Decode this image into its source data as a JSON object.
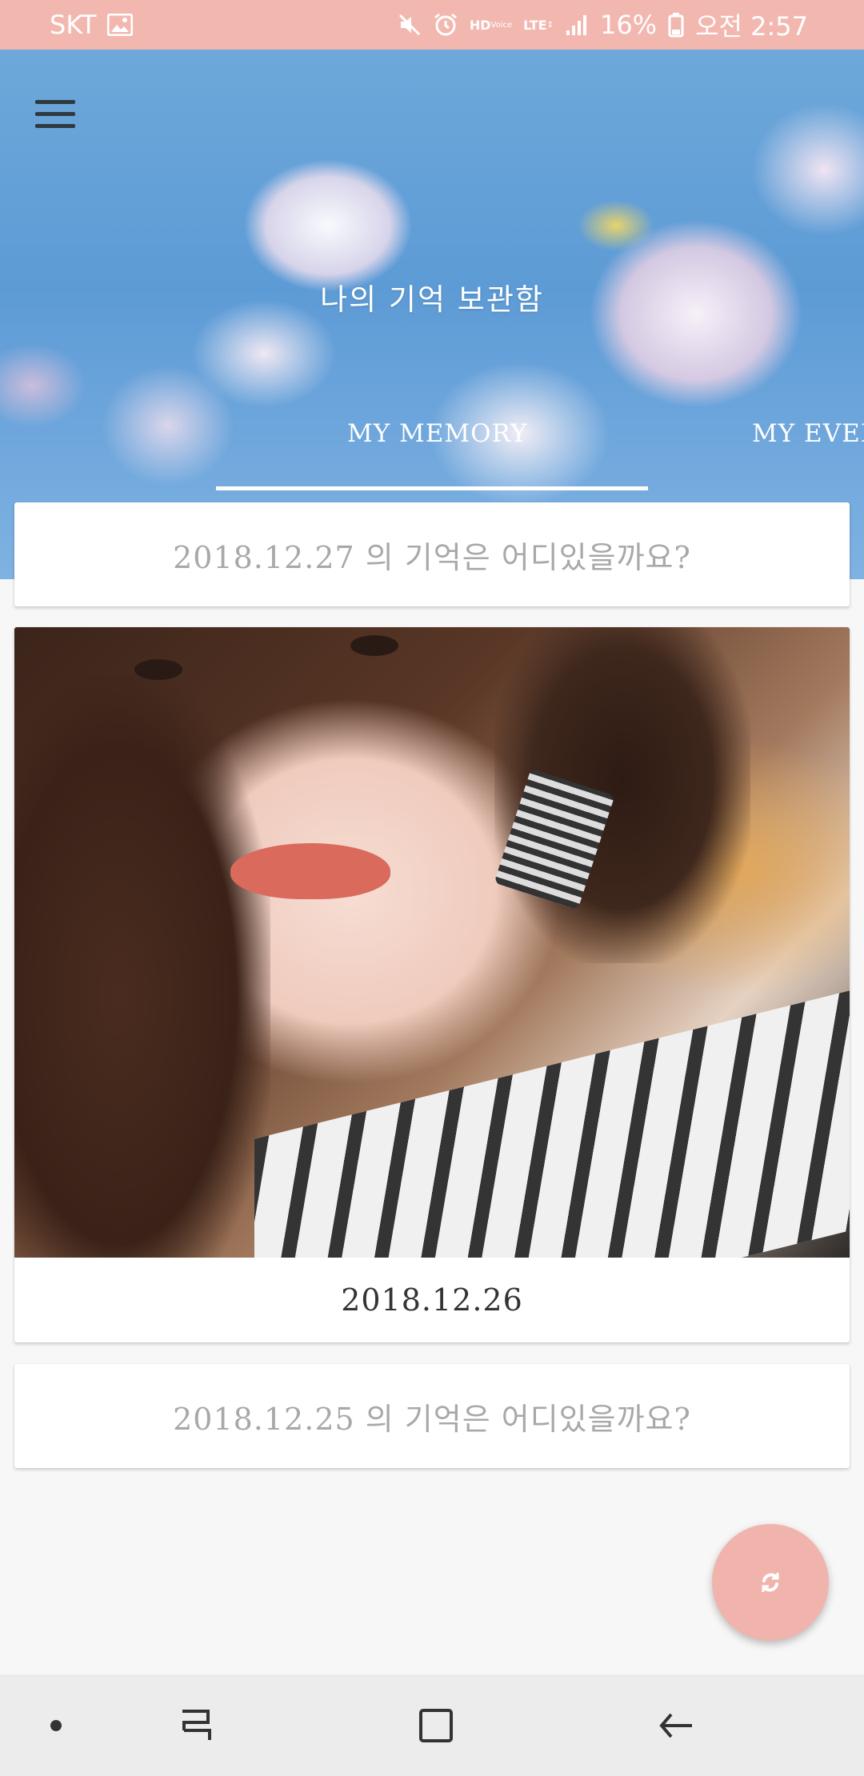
{
  "status_bar": {
    "carrier": "SKT",
    "battery": "16%",
    "time": "오전 2:57",
    "hd_label": "HD",
    "voice_label": "Voice",
    "lte_label": "LTE",
    "icons": [
      "gallery-icon",
      "mute-icon",
      "alarm-icon",
      "hd-voice-icon",
      "lte-icon",
      "signal-icon",
      "battery-icon"
    ]
  },
  "header": {
    "title": "나의 기억 보관함",
    "tabs": [
      {
        "label": "MY MEMORY",
        "selected": true
      },
      {
        "label": "MY EVER",
        "selected": false
      }
    ],
    "menu_icon": "hamburger-icon"
  },
  "feed": {
    "cards": [
      {
        "type": "empty",
        "text": "2018.12.27 의 기억은 어디있을까요?"
      },
      {
        "type": "photo",
        "caption": "2018.12.26"
      },
      {
        "type": "empty",
        "text": "2018.12.25 의 기억은 어디있을까요?"
      }
    ]
  },
  "fab": {
    "icon": "refresh-icon",
    "color": "#f0b4ad"
  },
  "nav_bar": {
    "icons": [
      "dot-icon",
      "recent-apps-icon",
      "home-icon",
      "back-icon"
    ]
  },
  "colors": {
    "accent": "#f2b8b0",
    "empty_text": "#a8a8a8",
    "caption_text": "#333333"
  }
}
